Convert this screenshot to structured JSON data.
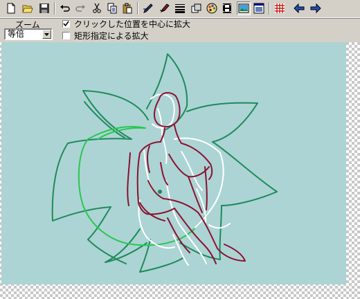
{
  "toolbar": {
    "buttons": [
      {
        "name": "new-file-icon"
      },
      {
        "name": "open-folder-icon"
      },
      {
        "name": "save-icon"
      },
      {
        "name": "undo-icon"
      },
      {
        "name": "redo-icon"
      },
      {
        "name": "cut-icon"
      },
      {
        "name": "copy-icon"
      },
      {
        "name": "paste-icon"
      },
      {
        "name": "pen-tool-icon"
      },
      {
        "name": "brush-tool-icon"
      },
      {
        "name": "line-width-icon"
      },
      {
        "name": "layers-icon"
      },
      {
        "name": "palette-icon"
      },
      {
        "name": "filmstrip-icon"
      },
      {
        "name": "view-image-icon"
      },
      {
        "name": "preview-window-icon"
      },
      {
        "name": "grid-icon"
      },
      {
        "name": "arrow-left-icon"
      },
      {
        "name": "arrow-right-icon"
      }
    ]
  },
  "options": {
    "zoom_label": "ズーム",
    "zoom_value": "等倍",
    "checkbox1": {
      "label": "クリックした位置を中心に拡大",
      "checked": true
    },
    "checkbox2": {
      "label": "矩形指定による拡大",
      "checked": false
    }
  },
  "colors": {
    "canvas_bg": "#acd4d4",
    "figure_outline": "#8b1030",
    "leaf_dark_green": "#1e8a5a",
    "leaf_light_green": "#28c850",
    "highlight_white": "#ffffff"
  }
}
